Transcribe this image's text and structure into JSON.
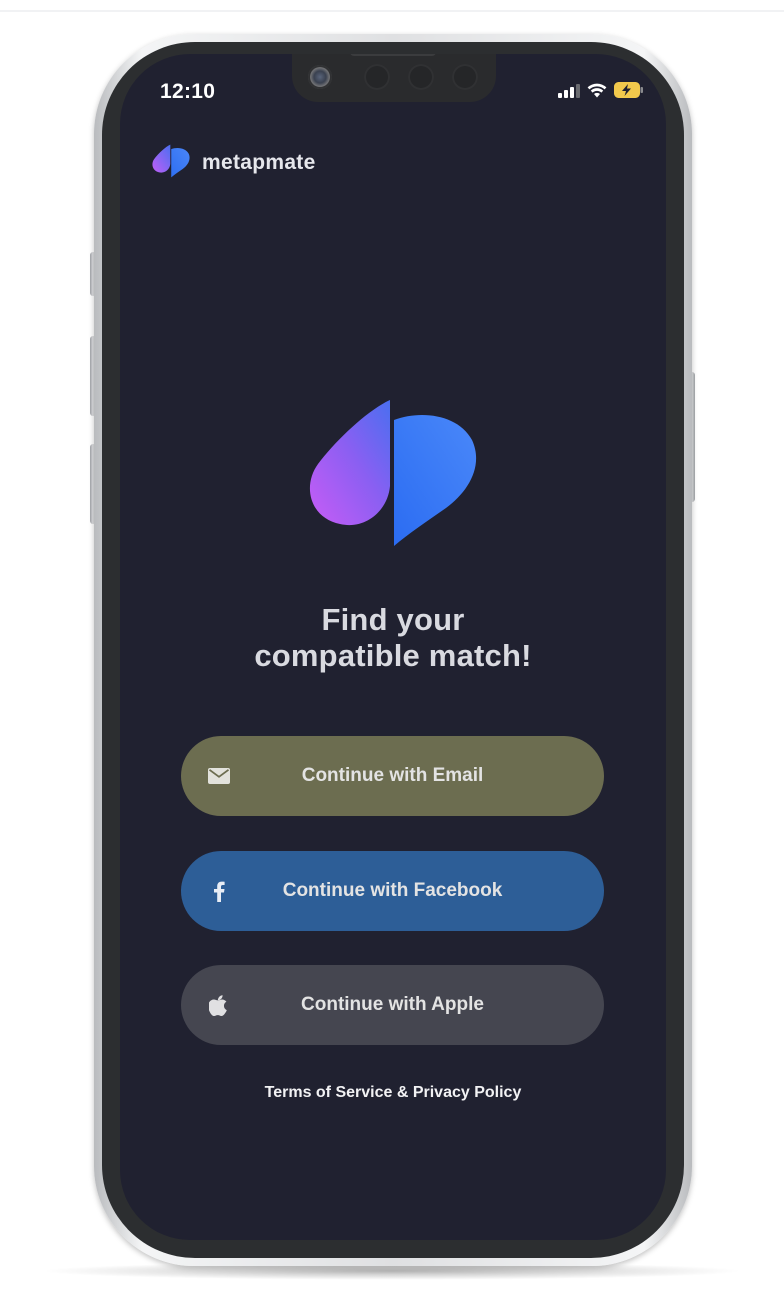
{
  "status_bar": {
    "time": "12:10",
    "signal_icon": "cellular-signal-icon",
    "wifi_icon": "wifi-icon",
    "battery_icon": "battery-charging-icon"
  },
  "brand": {
    "name": "metapmate",
    "logo_icon": "metapmate-logo-icon"
  },
  "hero": {
    "logo_icon": "metapmate-logo-icon",
    "headline_line1": "Find your",
    "headline_line2": "compatible match!"
  },
  "auth": {
    "email": {
      "label": "Continue with Email",
      "icon": "mail-icon",
      "color": "#6c6d50"
    },
    "facebook": {
      "label": "Continue with Facebook",
      "icon": "facebook-icon",
      "color": "#2d5e97"
    },
    "apple": {
      "label": "Continue with Apple",
      "icon": "apple-icon",
      "color": "#454650"
    }
  },
  "legal": {
    "text": "Terms of Service & Privacy Policy"
  },
  "colors": {
    "screen_background": "#202130",
    "logo_gradient_purple": "#c15ef7",
    "logo_gradient_blue": "#3b79f6"
  }
}
